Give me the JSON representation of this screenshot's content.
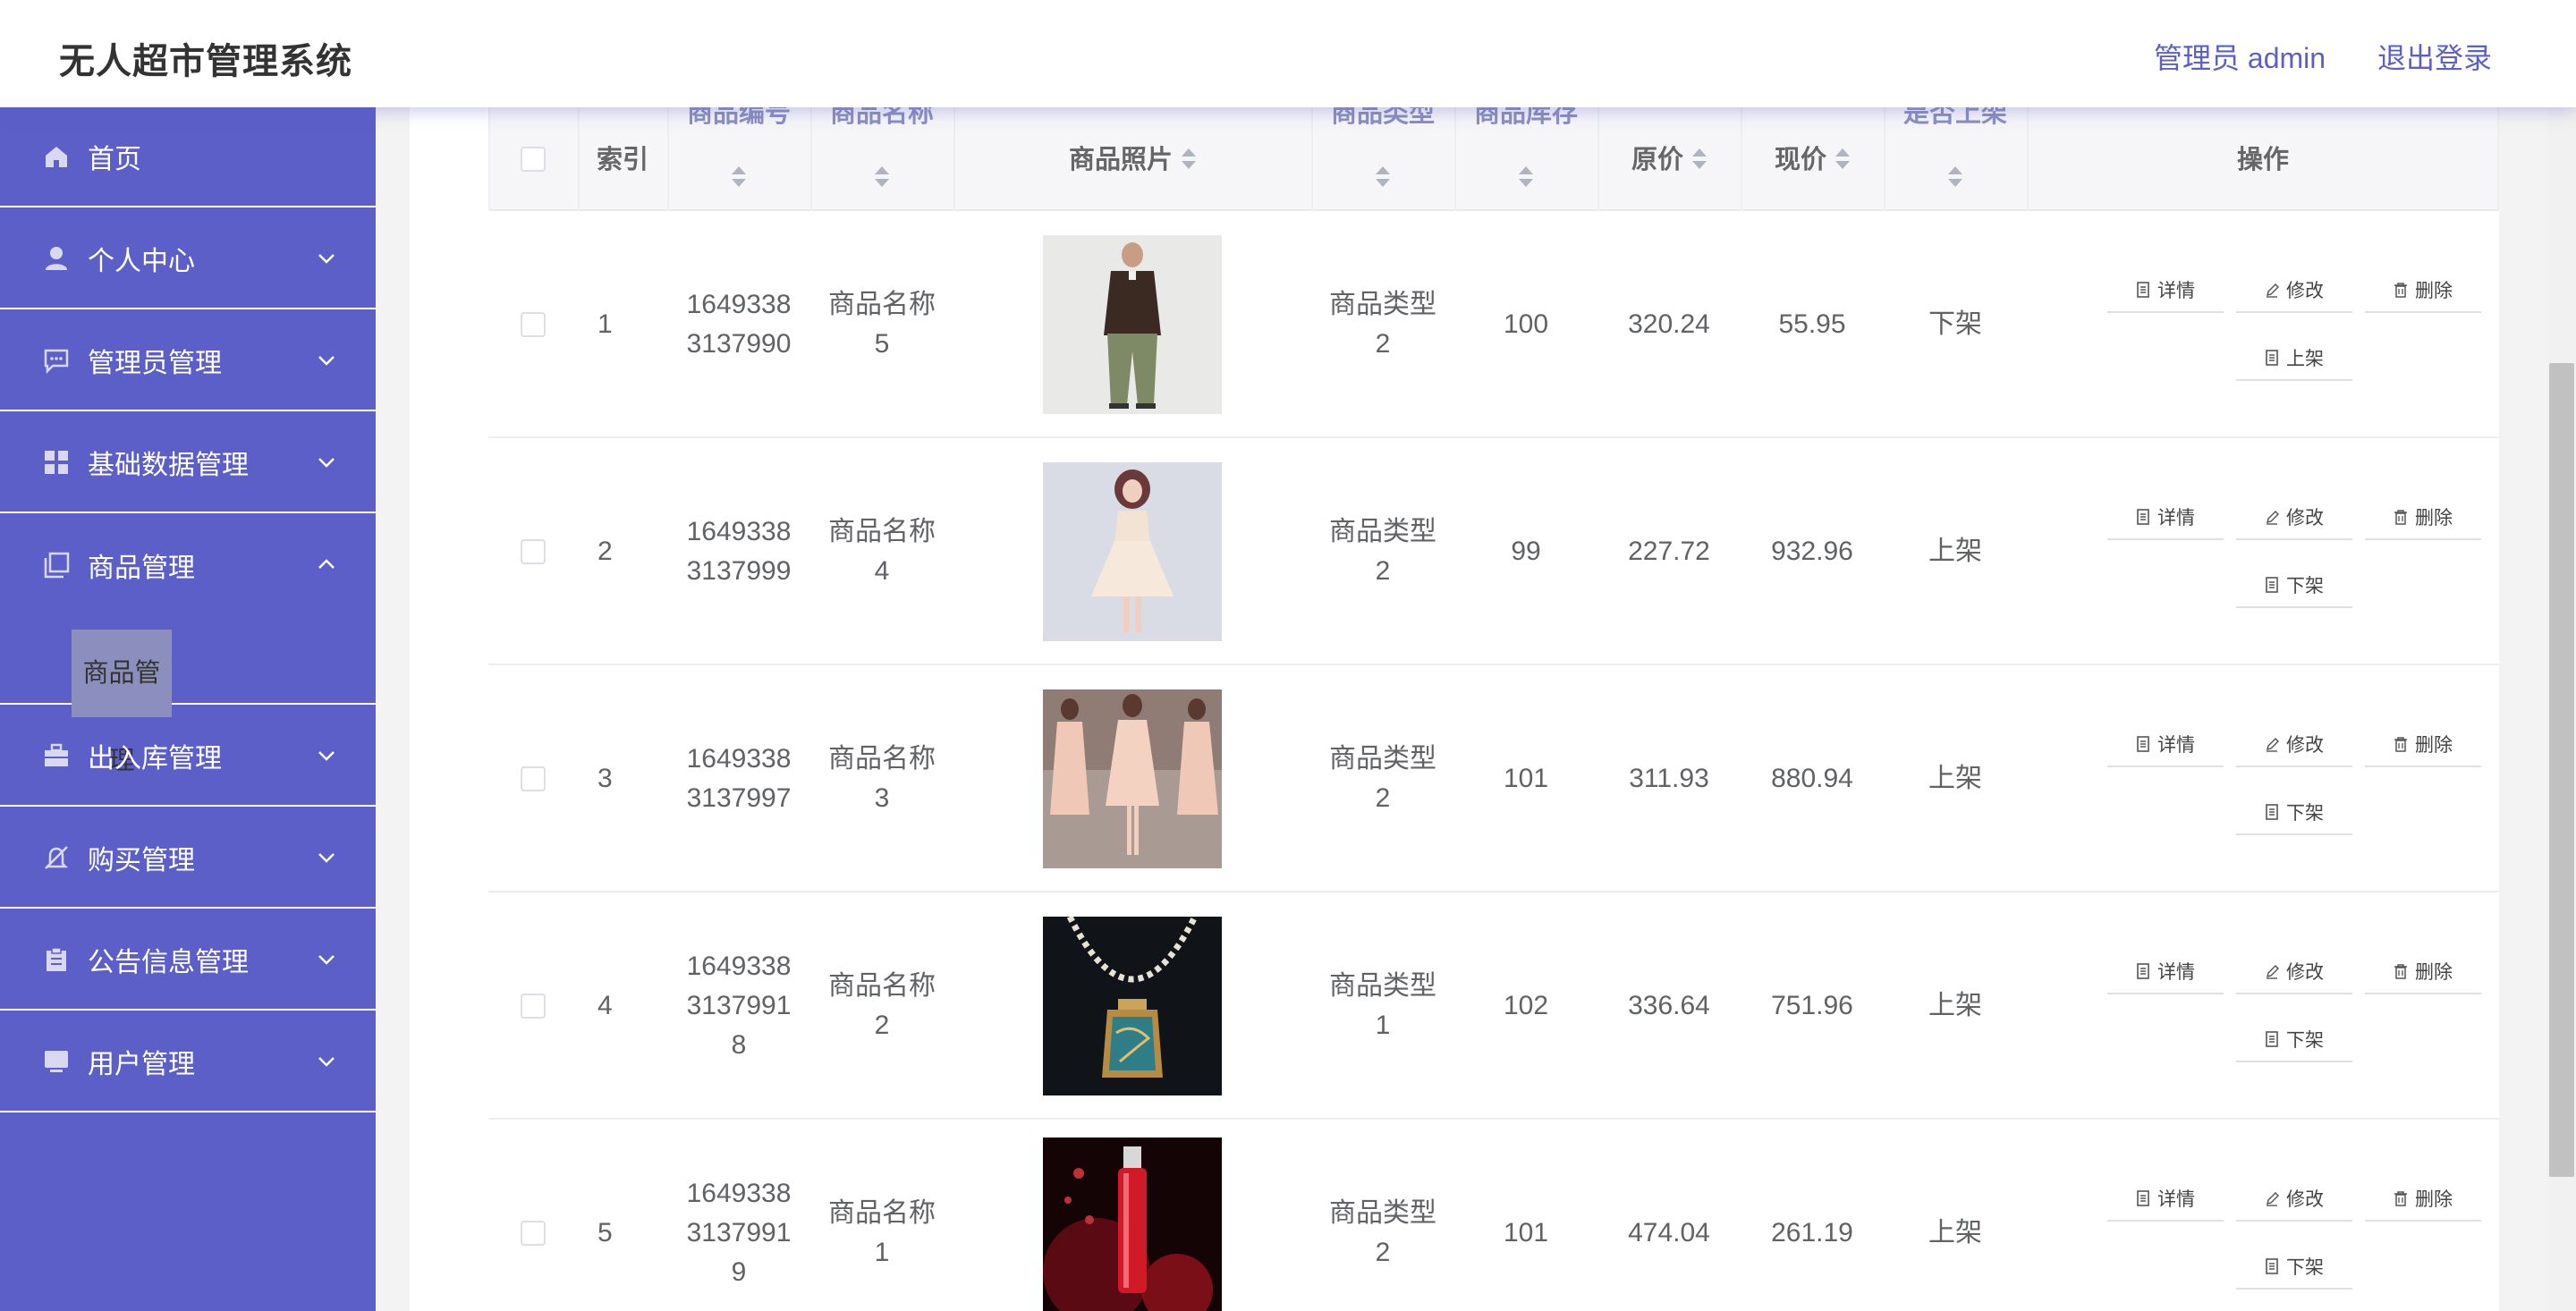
{
  "header": {
    "app_title": "无人超市管理系统",
    "user_label": "管理员 admin",
    "logout_label": "退出登录"
  },
  "sidebar": {
    "items": [
      {
        "label": "首页",
        "icon": "home-icon"
      },
      {
        "label": "个人中心",
        "icon": "user-icon"
      },
      {
        "label": "管理员管理",
        "icon": "chat-icon"
      },
      {
        "label": "基础数据管理",
        "icon": "grid-icon"
      },
      {
        "label": "商品管理",
        "icon": "copy-icon",
        "expanded": true
      },
      {
        "label": "出入库管理",
        "icon": "briefcase-icon"
      },
      {
        "label": "购买管理",
        "icon": "bell-off-icon"
      },
      {
        "label": "公告信息管理",
        "icon": "clipboard-icon"
      },
      {
        "label": "用户管理",
        "icon": "monitor-icon"
      }
    ],
    "submenu_active": "商品管理"
  },
  "table": {
    "headers": {
      "index": "索引",
      "code": "商品编号",
      "name": "商品名称",
      "photo": "商品照片",
      "type": "商品类型",
      "stock": "商品库存",
      "orig_price": "原价",
      "cur_price": "现价",
      "on_shelf": "是否上架",
      "actions": "操作"
    },
    "rows": [
      {
        "index": "1",
        "code": "16493383137990",
        "name": "商品名称5",
        "type": "商品类型2",
        "stock": "100",
        "orig_price": "320.24",
        "cur_price": "55.95",
        "status": "下架",
        "toggle": "上架",
        "photo": "man-in-jacket"
      },
      {
        "index": "2",
        "code": "16493383137999",
        "name": "商品名称4",
        "type": "商品类型2",
        "stock": "99",
        "orig_price": "227.72",
        "cur_price": "932.96",
        "status": "上架",
        "toggle": "下架",
        "photo": "woman-white-dress"
      },
      {
        "index": "3",
        "code": "16493383137997",
        "name": "商品名称3",
        "type": "商品类型2",
        "stock": "101",
        "orig_price": "311.93",
        "cur_price": "880.94",
        "status": "上架",
        "toggle": "下架",
        "photo": "pink-dresses"
      },
      {
        "index": "4",
        "code": "164933831379918",
        "name": "商品名称2",
        "type": "商品类型1",
        "stock": "102",
        "orig_price": "336.64",
        "cur_price": "751.96",
        "status": "上架",
        "toggle": "下架",
        "photo": "pendant-necklace"
      },
      {
        "index": "5",
        "code": "164933831379919",
        "name": "商品名称1",
        "type": "商品类型2",
        "stock": "101",
        "orig_price": "474.04",
        "cur_price": "261.19",
        "status": "上架",
        "toggle": "下架",
        "photo": "red-perfume"
      }
    ],
    "action_labels": {
      "detail": "详情",
      "edit": "修改",
      "delete": "删除"
    }
  },
  "colors": {
    "accent": "#5c5fc8",
    "sidebar_bg": "#5c5fc8",
    "submenu_highlight": "#8c8fbe"
  }
}
